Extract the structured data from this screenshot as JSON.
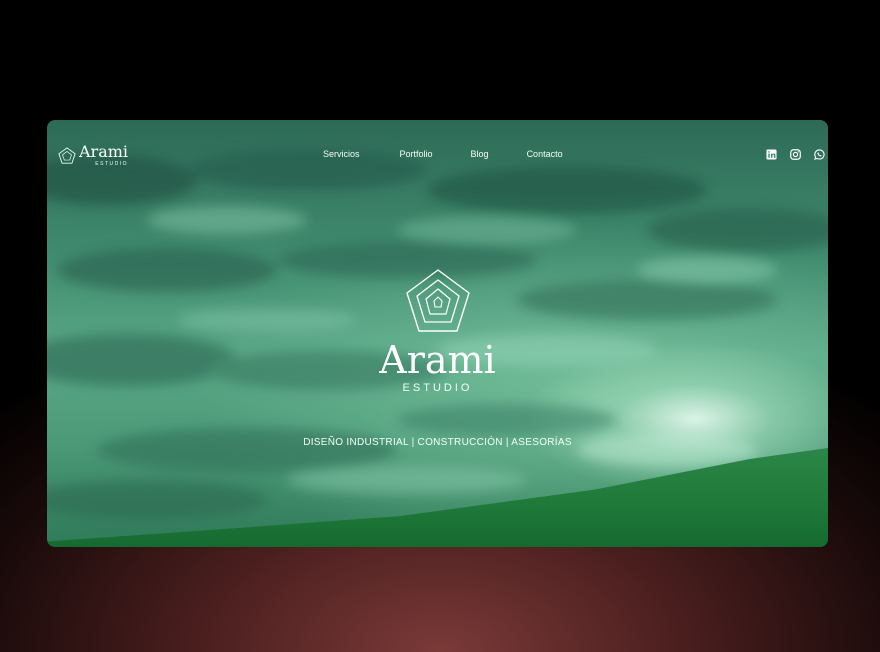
{
  "nav": {
    "logo_word": "Arami",
    "logo_sub": "ESTUDIO",
    "links": [
      {
        "label": "Servicios"
      },
      {
        "label": "Portfolio"
      },
      {
        "label": "Blog"
      },
      {
        "label": "Contacto"
      }
    ],
    "social": [
      {
        "icon": "linkedin-icon"
      },
      {
        "icon": "instagram-icon"
      },
      {
        "icon": "whatsapp-icon"
      }
    ]
  },
  "hero": {
    "brand": "Arami",
    "brand_sub": "ESTUDIO",
    "tagline": "DISEÑO INDUSTRIAL | CONSTRUCCIÓN | ASESORÍAS"
  },
  "colors": {
    "page_bg": "#000000",
    "glow": "#7a3a38",
    "sky": "#4c9a78",
    "hill": "#1f7a3a",
    "text": "#ffffff"
  }
}
